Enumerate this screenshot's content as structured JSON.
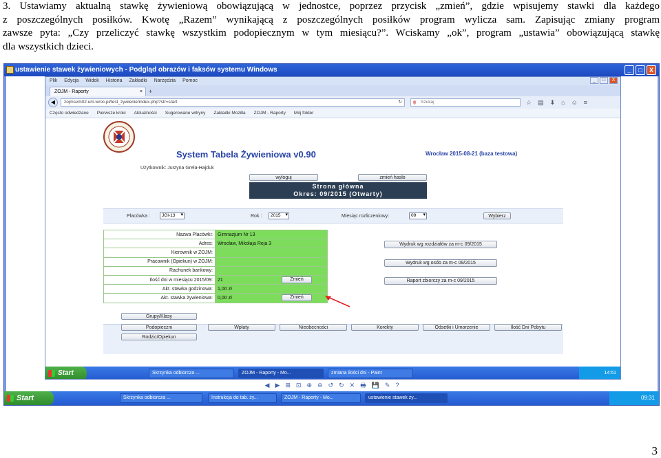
{
  "document": {
    "lines": [
      "3.  Ustawiamy  aktualną  stawkę  żywieniową  obowiązującą  w  jednostce,  poprzez  przycisk  „zmień”,  gdzie  wpisujemy  stawki  dla  każdego",
      "z  poszczególnych  posiłków.  Kwotę  „Razem”  wynikającą  z  poszczególnych  posiłków  program  wylicza  sam.  Zapisując  zmiany  program",
      "zawsze pyta: „Czy przeliczyć stawkę wszystkim podopiecznym w tym miesiącu?”. Wciskamy „ok”, program „ustawia” obowiązującą stawkę",
      "dla wszystkich dzieci."
    ],
    "page_number": "3"
  },
  "viewer": {
    "title": "ustawienie stawek żywieniowych - Podgląd obrazów i faksów systemu Windows",
    "buttons": [
      "_",
      "□",
      "X"
    ]
  },
  "browser": {
    "menu": [
      "Plik",
      "Edycja",
      "Widok",
      "Historia",
      "Zakładki",
      "Narzędzia",
      "Pomoc"
    ],
    "tab_title": "ZOJM - Raporty",
    "tab_close": "×",
    "new_tab": "+",
    "url": "zojmsvm02.um.wroc.pl/test_zywienie/index.php?str=start",
    "search_placeholder": "Szukaj",
    "bookmarks": [
      "Często odwiedzane",
      "Pierwsze kroki",
      "Aktualności",
      "Sugerowane witryny",
      "Zakładki Mozilla",
      "ZOJM - Raporty",
      "Mój folder"
    ]
  },
  "app": {
    "title": "System Tabela Żywieniowa v0.90",
    "date_line": "Wrocław 2015-08-21 (baza testowa)",
    "user_line": "Użytkownik: Justyna Grela-Hajduk",
    "logout_label": "wyloguj",
    "change_password_label": "zmień hasło",
    "banner_line1": "Strona główna",
    "banner_line2": "Okres: 09/2015 (Otwarty)",
    "filters": {
      "placowka_label": "Placówka :",
      "placowka_value": "JGI-13",
      "rok_label": "Rok :",
      "rok_value": "2015",
      "miesiac_label": "Miesiąc rozliczeniowy:",
      "miesiac_value": "09",
      "select_button": "Wybierz"
    },
    "info_rows": [
      {
        "label": "Nazwa Placówki:",
        "value": "Gimnazjum Nr 13",
        "button": ""
      },
      {
        "label": "Adres:",
        "value": "Wrocław, Mikołaja Reja 3",
        "button": ""
      },
      {
        "label": "Kierownik w ZOJM:",
        "value": "",
        "button": ""
      },
      {
        "label": "Pracownik (Opiekun) w ZOJM:",
        "value": "",
        "button": ""
      },
      {
        "label": "Rachunek bankowy:",
        "value": "",
        "button": ""
      },
      {
        "label": "Ilość dni w miesiącu 2015/09:",
        "value": "21",
        "button": "Zmień"
      },
      {
        "label": "Akt. stawka godzinowa:",
        "value": "1,00 zł",
        "button": ""
      },
      {
        "label": "Akt. stawka żywieniowa:",
        "value": "0,00 zł",
        "button": "Zmień"
      }
    ],
    "reports": [
      "Wydruk wg rozdziałów za m-c 09/2015",
      "Wydruk wg osób za m-c 09/2015",
      "Raport zbiorczy za m-c 09/2015"
    ],
    "left_buttons": [
      "Grupy/Klasy",
      "Podopieczni",
      "Rodzic/Opiekun"
    ],
    "bottom_buttons": [
      "Wpłaty",
      "Nieobecności",
      "Korekty",
      "Odsetki i Umorzenie",
      "Ilość Dni Pobytu"
    ]
  },
  "inner_taskbar": {
    "start": "Start",
    "tasks": [
      "Skrzynka odbiorcza ...",
      "ZOJM - Raporty - Mo...",
      "zmiana ilości dni - Paint"
    ],
    "clock": "14:51"
  },
  "viewer_toolbar": [
    "◀",
    "▶",
    "⊞",
    "⊡",
    "⊕",
    "⊖",
    "↺",
    "↻",
    "✕",
    "🖶",
    "💾",
    "✎",
    "?"
  ],
  "outer_taskbar": {
    "start": "Start",
    "tasks": [
      "Skrzynka odbiorcza ...",
      "Instrukcja do tab. ży...",
      "ZOJM - Raporty - Mo...",
      "ustawienie stawek ży..."
    ],
    "clock": "09:31"
  }
}
